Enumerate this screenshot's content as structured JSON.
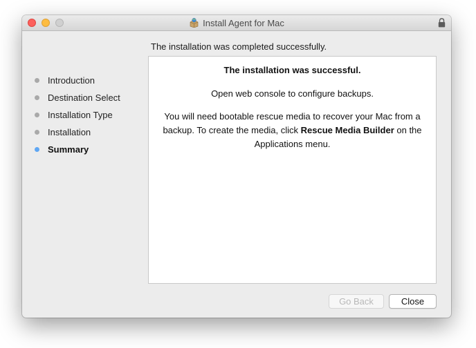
{
  "window": {
    "title": "Install Agent for Mac",
    "app_icon": "installer-package-icon",
    "lock_icon": "lock-icon"
  },
  "header": {
    "status_text": "The installation was completed successfully."
  },
  "sidebar": {
    "steps": [
      {
        "label": "Introduction",
        "active": false
      },
      {
        "label": "Destination Select",
        "active": false
      },
      {
        "label": "Installation Type",
        "active": false
      },
      {
        "label": "Installation",
        "active": false
      },
      {
        "label": "Summary",
        "active": true
      }
    ]
  },
  "content": {
    "headline": "The installation was successful.",
    "console_text": "Open web console to configure backups.",
    "media_text_before": "You will need bootable rescue media to recover your Mac from a backup. To create the media, click ",
    "media_text_bold": "Rescue Media Builder",
    "media_text_after": " on the Applications menu."
  },
  "buttons": {
    "go_back": {
      "label": "Go Back",
      "enabled": false
    },
    "close": {
      "label": "Close",
      "enabled": true
    }
  },
  "colors": {
    "close_button": "#fc605c",
    "minimize_button": "#fdbc40",
    "zoom_button": "#d0d0d0",
    "active_step_dot": "#5fa7f4",
    "inactive_step_dot": "#a9a9a9"
  }
}
